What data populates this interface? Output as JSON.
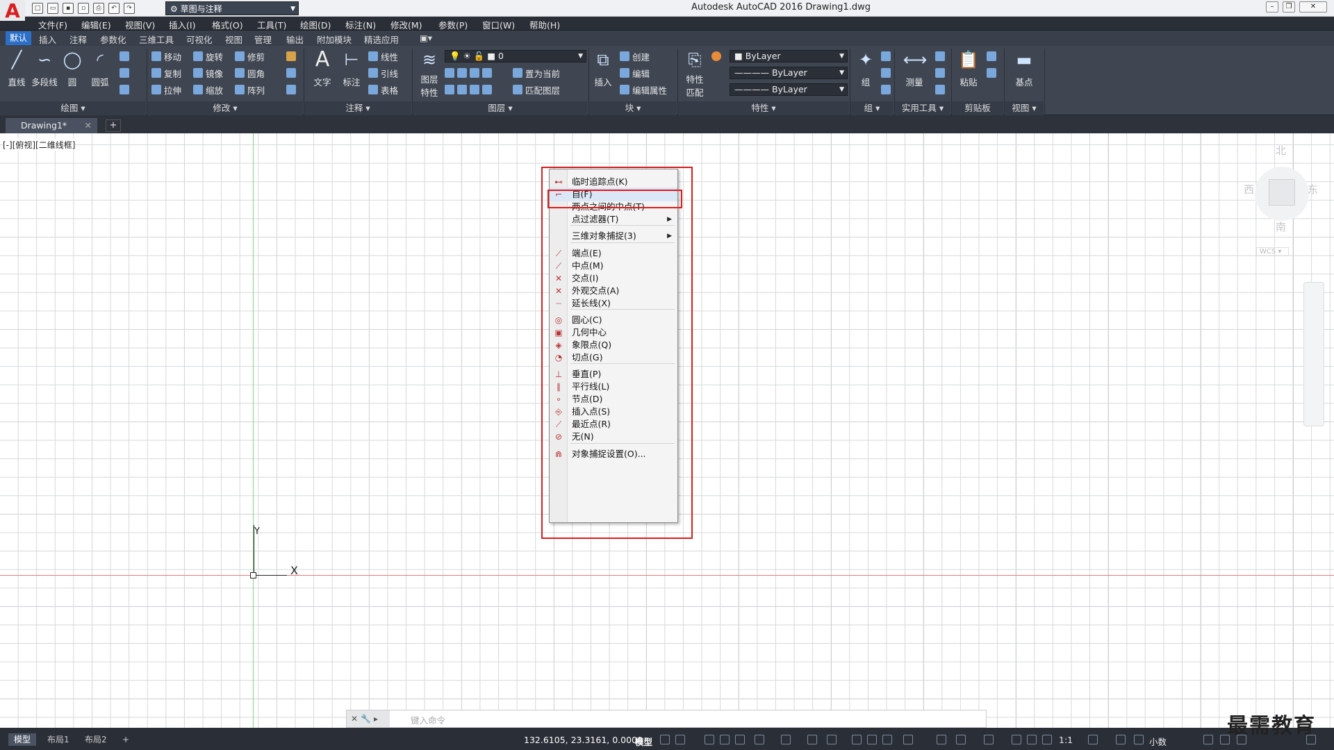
{
  "window": {
    "title": "Autodesk AutoCAD 2016    Drawing1.dwg",
    "workspace": "草图与注释"
  },
  "menubar": [
    "文件(F)",
    "编辑(E)",
    "视图(V)",
    "插入(I)",
    "格式(O)",
    "工具(T)",
    "绘图(D)",
    "标注(N)",
    "修改(M)",
    "参数(P)",
    "窗口(W)",
    "帮助(H)"
  ],
  "ribbon_tabs": [
    "默认",
    "插入",
    "注释",
    "参数化",
    "三维工具",
    "可视化",
    "视图",
    "管理",
    "输出",
    "附加模块",
    "精选应用"
  ],
  "ribbon": {
    "draw": {
      "line": "直线",
      "polyline": "多段线",
      "circle": "圆",
      "arc": "圆弧",
      "title": "绘图"
    },
    "modify": {
      "move": "移动",
      "rotate": "旋转",
      "trim": "修剪",
      "copy": "复制",
      "mirror": "镜像",
      "fillet": "圆角",
      "stretch": "拉伸",
      "scale": "缩放",
      "array": "阵列",
      "title": "修改"
    },
    "annotation": {
      "text": "文字",
      "dimension": "标注",
      "linear": "线性",
      "leader": "引线",
      "table": "表格",
      "title": "注释"
    },
    "layers": {
      "properties": "图层\n特性",
      "current_layer": "0",
      "set_current": "置为当前",
      "match_layer": "匹配图层",
      "title": "图层"
    },
    "block": {
      "insert": "插入",
      "create": "创建",
      "edit": "编辑",
      "edit_attr": "编辑属性",
      "title": "块"
    },
    "properties": {
      "match": "特性\n匹配",
      "color": "ByLayer",
      "linetype": "ByLayer",
      "lineweight": "ByLayer",
      "title": "特性"
    },
    "groups": {
      "group": "组",
      "title": "组"
    },
    "utilities": {
      "measure": "测量",
      "title": "实用工具"
    },
    "clipboard": {
      "paste": "粘贴",
      "title": "剪贴板"
    },
    "view": {
      "base": "基点",
      "title": "视图"
    }
  },
  "doc_tab": {
    "name": "Drawing1*"
  },
  "viewport_label": "[-][俯视][二维线框]",
  "ucs": {
    "x": "X",
    "y": "Y"
  },
  "viewcube": {
    "north": "北",
    "south": "南",
    "east": "东",
    "west": "西",
    "wcs": "WCS"
  },
  "context_menu": {
    "items": [
      {
        "label": "临时追踪点(K)",
        "icon": "temp-track-icon"
      },
      {
        "label": "自(F)",
        "icon": "from-icon",
        "highlighted": true
      },
      {
        "label": "两点之间的中点(T)",
        "icon": ""
      },
      {
        "label": "点过滤器(T)",
        "submenu": true
      },
      {
        "label": "三维对象捕捉(3)",
        "submenu": true
      },
      {
        "label": "端点(E)",
        "icon": "endpoint-icon"
      },
      {
        "label": "中点(M)",
        "icon": "midpoint-icon"
      },
      {
        "label": "交点(I)",
        "icon": "intersection-icon"
      },
      {
        "label": "外观交点(A)",
        "icon": "apparent-intersection-icon"
      },
      {
        "label": "延长线(X)",
        "icon": "extension-icon"
      },
      {
        "label": "圆心(C)",
        "icon": "center-icon"
      },
      {
        "label": "几何中心",
        "icon": "geometric-center-icon"
      },
      {
        "label": "象限点(Q)",
        "icon": "quadrant-icon"
      },
      {
        "label": "切点(G)",
        "icon": "tangent-icon"
      },
      {
        "label": "垂直(P)",
        "icon": "perpendicular-icon"
      },
      {
        "label": "平行线(L)",
        "icon": "parallel-icon"
      },
      {
        "label": "节点(D)",
        "icon": "node-icon"
      },
      {
        "label": "插入点(S)",
        "icon": "insertion-icon"
      },
      {
        "label": "最近点(R)",
        "icon": "nearest-icon"
      },
      {
        "label": "无(N)",
        "icon": "none-icon"
      },
      {
        "label": "对象捕捉设置(O)...",
        "icon": "osnap-settings-icon"
      }
    ]
  },
  "command_line": {
    "placeholder": "键入命令"
  },
  "statusbar": {
    "layouts": [
      "模型",
      "布局1",
      "布局2"
    ],
    "coordinates": "132.6105, 23.3161, 0.0000",
    "model": "模型",
    "scale": "1:1",
    "units": "小数"
  },
  "watermark": "最需教育"
}
